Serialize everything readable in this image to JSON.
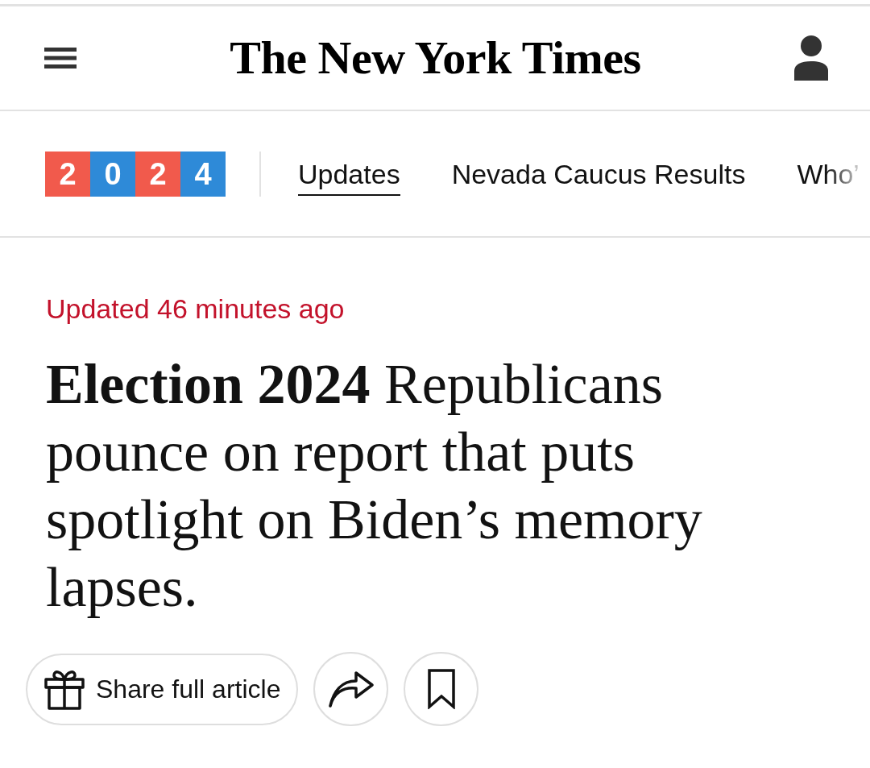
{
  "header": {
    "logo": "The New York Times"
  },
  "section_nav": {
    "badge": [
      {
        "digit": "2",
        "color": "#f15a4c"
      },
      {
        "digit": "0",
        "color": "#2e8ad8"
      },
      {
        "digit": "2",
        "color": "#f15a4c"
      },
      {
        "digit": "4",
        "color": "#2e8ad8"
      }
    ],
    "tabs": [
      {
        "label": "Updates",
        "selected": true
      },
      {
        "label": "Nevada Caucus Results",
        "selected": false
      },
      {
        "label": "Who’",
        "selected": false
      }
    ]
  },
  "article": {
    "timestamp": "Updated 46 minutes ago",
    "headline": "**Election 2024** Republicans pounce on report that puts spotlight on Biden’s memory lapses."
  },
  "actions": [
    {
      "kind": "gift",
      "label": "Share full article"
    },
    {
      "kind": "share"
    },
    {
      "kind": "bookmark"
    }
  ]
}
